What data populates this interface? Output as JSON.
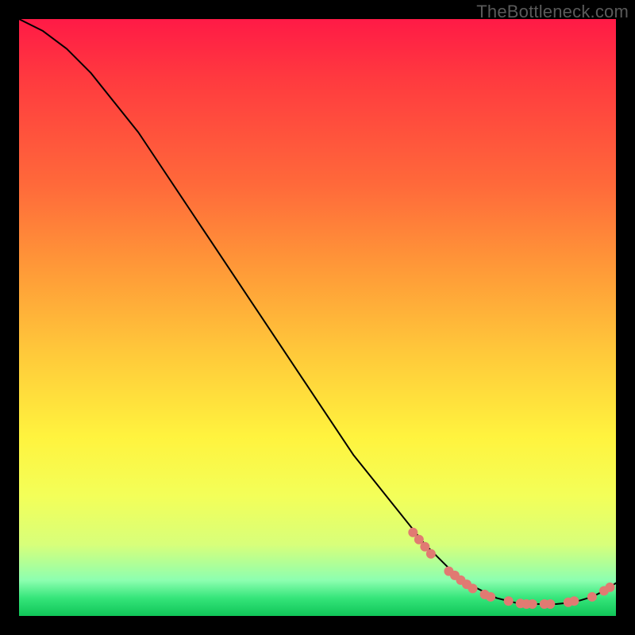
{
  "watermark": "TheBottleneck.com",
  "chart_data": {
    "type": "line",
    "title": "",
    "xlabel": "",
    "ylabel": "",
    "xlim": [
      0,
      100
    ],
    "ylim": [
      0,
      100
    ],
    "grid": false,
    "legend": false,
    "series": [
      {
        "name": "curve",
        "x": [
          0,
          4,
          8,
          12,
          16,
          20,
          24,
          28,
          32,
          36,
          40,
          44,
          48,
          52,
          56,
          60,
          64,
          68,
          70,
          72,
          74,
          76,
          78,
          80,
          82,
          84,
          86,
          88,
          90,
          92,
          94,
          96,
          98,
          100
        ],
        "values": [
          100,
          98,
          95,
          91,
          86,
          81,
          75,
          69,
          63,
          57,
          51,
          45,
          39,
          33,
          27,
          22,
          17,
          12,
          10,
          8,
          6,
          5,
          4,
          3,
          2.5,
          2,
          2,
          2,
          2,
          2.2,
          2.6,
          3.2,
          4.2,
          5.5
        ]
      }
    ],
    "markers": {
      "name": "highlight-points",
      "color": "#e17a72",
      "points_xy": [
        [
          66,
          14.0
        ],
        [
          67,
          12.8
        ],
        [
          68,
          11.6
        ],
        [
          69,
          10.4
        ],
        [
          72,
          7.5
        ],
        [
          73,
          6.8
        ],
        [
          74,
          6.0
        ],
        [
          75,
          5.3
        ],
        [
          76,
          4.6
        ],
        [
          78,
          3.6
        ],
        [
          79,
          3.2
        ],
        [
          82,
          2.5
        ],
        [
          84,
          2.1
        ],
        [
          85,
          2.0
        ],
        [
          86,
          2.0
        ],
        [
          88,
          2.0
        ],
        [
          89,
          2.0
        ],
        [
          92,
          2.3
        ],
        [
          93,
          2.5
        ],
        [
          96,
          3.2
        ],
        [
          98,
          4.2
        ],
        [
          99,
          4.8
        ]
      ]
    }
  }
}
